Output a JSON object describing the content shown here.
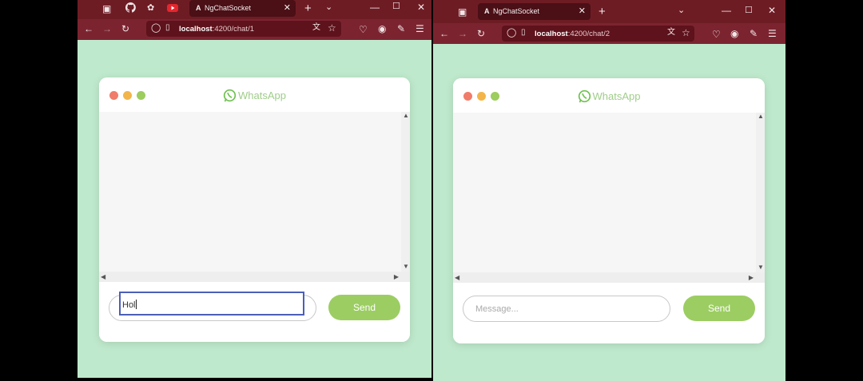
{
  "windows": [
    {
      "id": "left",
      "tab_title": "NgChatSocket",
      "url_host": "localhost",
      "url_path": ":4200/chat/1",
      "app_title": "WhatsApp",
      "input_value": "Hol",
      "input_placeholder": "",
      "send_label": "Send"
    },
    {
      "id": "right",
      "tab_title": "NgChatSocket",
      "url_host": "localhost",
      "url_path": ":4200/chat/2",
      "app_title": "WhatsApp",
      "input_value": "",
      "input_placeholder": "Message...",
      "send_label": "Send"
    }
  ],
  "colors": {
    "browser_tabbar": "#6e1c24",
    "browser_navbar": "#7b2430",
    "page_background": "#bfe9cc",
    "brand_green": "#a0cd8a",
    "send_button": "#9ccd62",
    "dot_red": "#f07c6a",
    "dot_yellow": "#f3b54a",
    "dot_green": "#9dcc5f"
  },
  "icons": {
    "tabbar_left": [
      "tab-list-icon",
      "github-icon",
      "chatgpt-icon",
      "youtube-icon"
    ],
    "nav": [
      "back-icon",
      "forward-icon",
      "reload-icon",
      "shield-icon",
      "page-icon"
    ],
    "toolbar": [
      "translate-icon",
      "star-icon",
      "pocket-icon",
      "account-icon",
      "extensions-icon",
      "menu-icon"
    ]
  }
}
